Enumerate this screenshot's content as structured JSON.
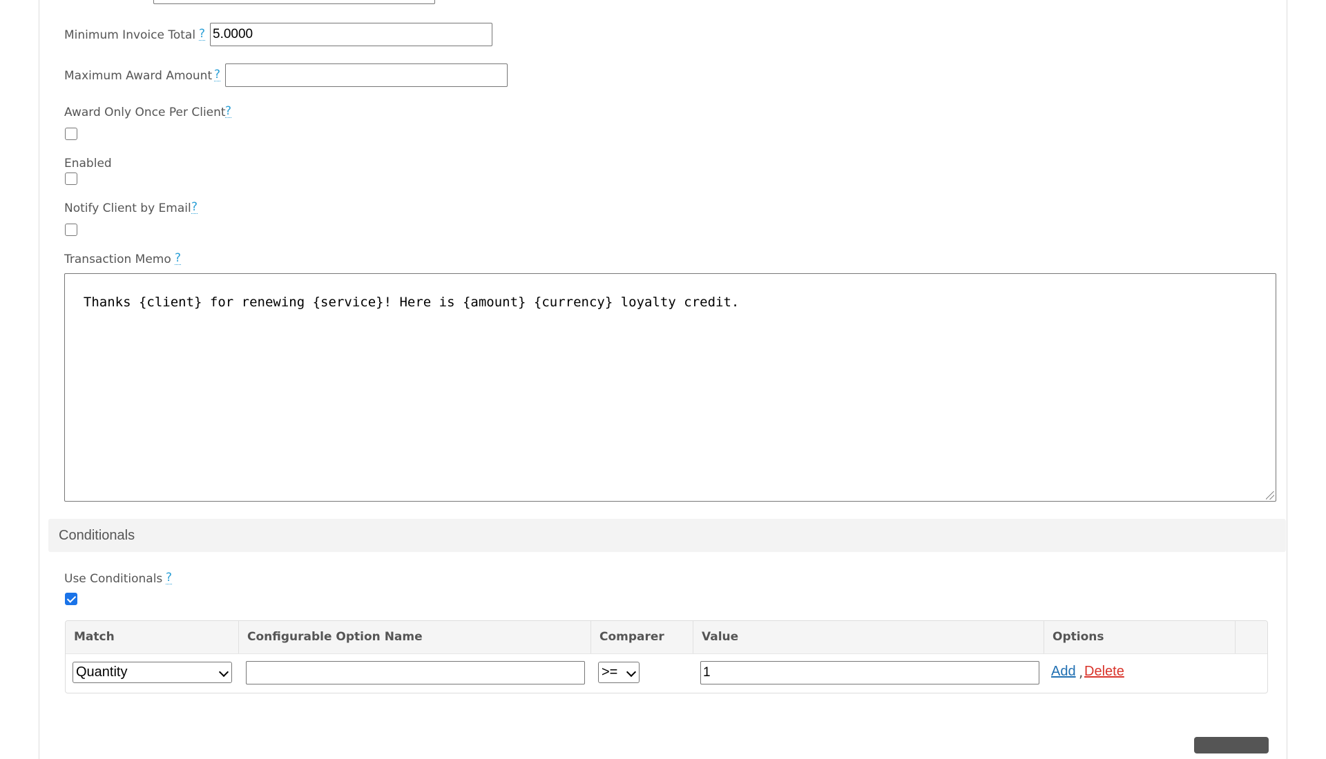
{
  "form": {
    "minimum_invoice_total": {
      "label": "Minimum Invoice Total",
      "help": "?",
      "value": "5.0000"
    },
    "maximum_award_amount": {
      "label": "Maximum Award Amount",
      "help": "?",
      "value": ""
    },
    "award_only_once": {
      "label": "Award Only Once Per Client",
      "help": "?",
      "checked": false
    },
    "enabled": {
      "label": "Enabled",
      "checked": false
    },
    "notify_client": {
      "label": "Notify Client by Email",
      "help": "?",
      "checked": false
    },
    "transaction_memo": {
      "label": "Transaction Memo",
      "help": "?",
      "value": "Thanks {client} for renewing {service}! Here is {amount} {currency} loyalty credit."
    }
  },
  "conditionals": {
    "section_title": "Conditionals",
    "use_conditionals": {
      "label": "Use Conditionals",
      "help": "?",
      "checked": true
    },
    "table": {
      "headers": [
        "Match",
        "Configurable Option Name",
        "Comparer",
        "Value",
        "Options"
      ],
      "rows": [
        {
          "match": "Quantity",
          "option_name": "",
          "comparer": ">=",
          "value": "1",
          "add_label": "Add",
          "separator": ",",
          "delete_label": "Delete"
        }
      ]
    }
  },
  "colors": {
    "help": "#2a9fd6",
    "add_link": "#1f6fb2",
    "delete_link": "#d9342b",
    "checkbox_checked": "#1a73e8"
  }
}
